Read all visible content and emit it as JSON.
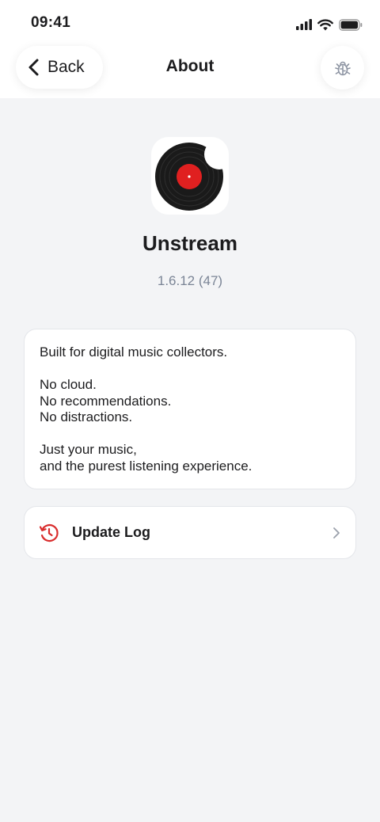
{
  "status_bar": {
    "time": "09:41"
  },
  "nav": {
    "back_label": "Back",
    "title": "About",
    "back_icon": "chevron-left-icon",
    "action_icon": "bug-icon"
  },
  "app": {
    "name": "Unstream",
    "version": "1.6.12 (47)",
    "icon": "vinyl-record-icon"
  },
  "description": {
    "paragraphs": [
      [
        "Built for digital music collectors."
      ],
      [
        "No cloud.",
        "No recommendations.",
        "No distractions."
      ],
      [
        "Just your music,",
        "and the purest listening experience."
      ]
    ]
  },
  "menu": {
    "update_log": {
      "label": "Update Log",
      "icon": "history-icon",
      "chevron_icon": "chevron-right-icon"
    }
  },
  "colors": {
    "background": "#f3f4f6",
    "accent_red": "#d92c2c",
    "text_primary": "#1c1c1e",
    "text_secondary": "#7b8596"
  }
}
